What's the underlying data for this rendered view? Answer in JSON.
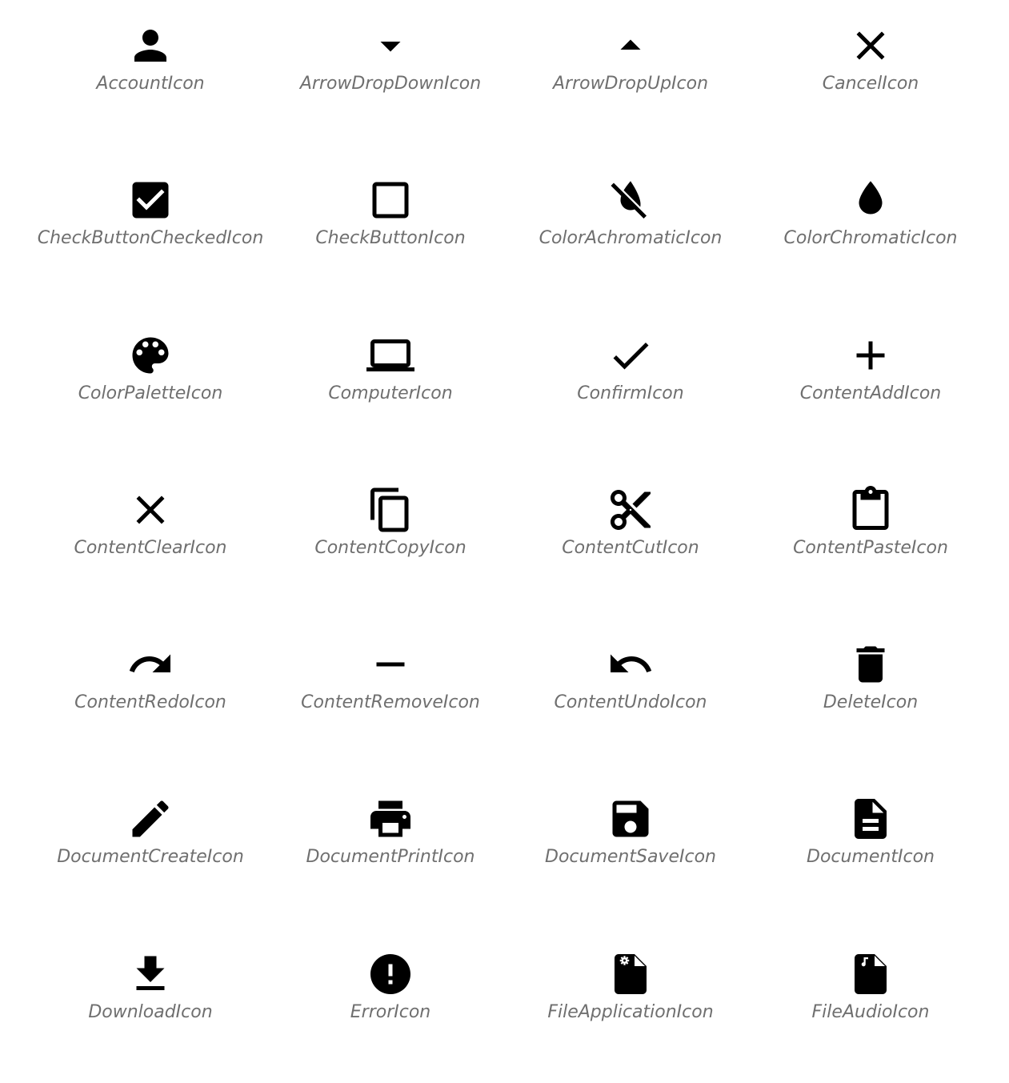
{
  "icons": [
    {
      "label": "AccountIcon",
      "icon": "account-icon"
    },
    {
      "label": "ArrowDropDownIcon",
      "icon": "arrow-drop-down-icon"
    },
    {
      "label": "ArrowDropUpIcon",
      "icon": "arrow-drop-up-icon"
    },
    {
      "label": "CancelIcon",
      "icon": "cancel-icon"
    },
    {
      "label": "CheckButtonCheckedIcon",
      "icon": "check-button-checked-icon"
    },
    {
      "label": "CheckButtonIcon",
      "icon": "check-button-icon"
    },
    {
      "label": "ColorAchromaticIcon",
      "icon": "color-achromatic-icon"
    },
    {
      "label": "ColorChromaticIcon",
      "icon": "color-chromatic-icon"
    },
    {
      "label": "ColorPaletteIcon",
      "icon": "color-palette-icon"
    },
    {
      "label": "ComputerIcon",
      "icon": "computer-icon"
    },
    {
      "label": "ConfirmIcon",
      "icon": "confirm-icon"
    },
    {
      "label": "ContentAddIcon",
      "icon": "content-add-icon"
    },
    {
      "label": "ContentClearIcon",
      "icon": "content-clear-icon"
    },
    {
      "label": "ContentCopyIcon",
      "icon": "content-copy-icon"
    },
    {
      "label": "ContentCutIcon",
      "icon": "content-cut-icon"
    },
    {
      "label": "ContentPasteIcon",
      "icon": "content-paste-icon"
    },
    {
      "label": "ContentRedoIcon",
      "icon": "content-redo-icon"
    },
    {
      "label": "ContentRemoveIcon",
      "icon": "content-remove-icon"
    },
    {
      "label": "ContentUndoIcon",
      "icon": "content-undo-icon"
    },
    {
      "label": "DeleteIcon",
      "icon": "delete-icon"
    },
    {
      "label": "DocumentCreateIcon",
      "icon": "document-create-icon"
    },
    {
      "label": "DocumentPrintIcon",
      "icon": "document-print-icon"
    },
    {
      "label": "DocumentSaveIcon",
      "icon": "document-save-icon"
    },
    {
      "label": "DocumentIcon",
      "icon": "document-icon"
    },
    {
      "label": "DownloadIcon",
      "icon": "download-icon"
    },
    {
      "label": "ErrorIcon",
      "icon": "error-icon"
    },
    {
      "label": "FileApplicationIcon",
      "icon": "file-application-icon"
    },
    {
      "label": "FileAudioIcon",
      "icon": "file-audio-icon"
    }
  ],
  "colors": {
    "icon": "#000000",
    "label": "#6f6f6f",
    "background": "#ffffff"
  }
}
